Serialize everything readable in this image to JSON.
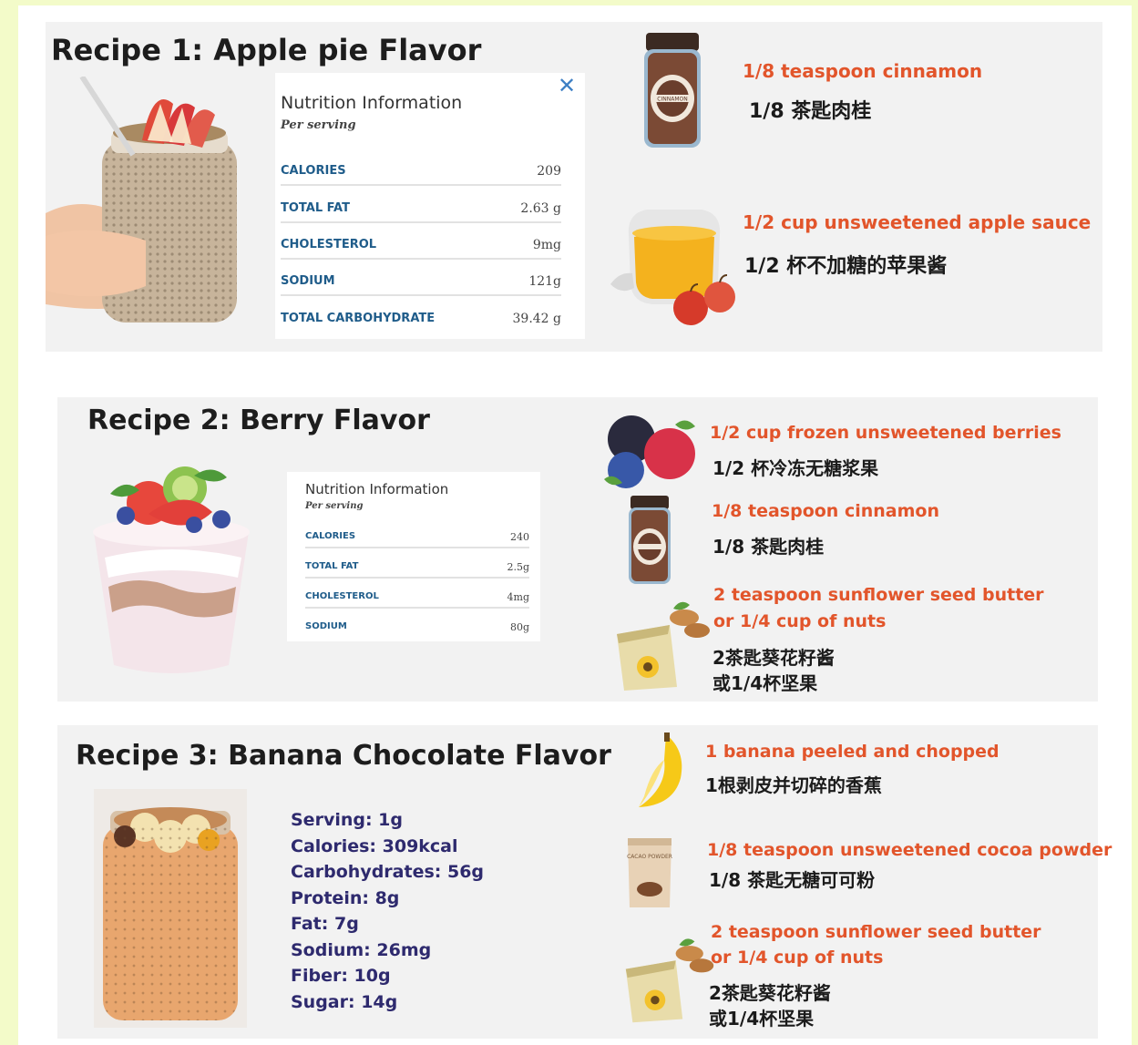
{
  "recipes": [
    {
      "title": "Recipe 1: Apple pie Flavor",
      "nutrition": {
        "heading": "Nutrition Information",
        "per": "Per serving",
        "rows": [
          {
            "label": "CALORIES",
            "value": "209"
          },
          {
            "label": "TOTAL FAT",
            "value": "2.63 g"
          },
          {
            "label": "CHOLESTEROL",
            "value": "9mg"
          },
          {
            "label": "SODIUM",
            "value": "121g"
          },
          {
            "label": "TOTAL CARBOHYDRATE",
            "value": "39.42 g"
          }
        ]
      },
      "ingredients": [
        {
          "en": "1/8 teaspoon cinnamon",
          "zh": "1/8 茶匙肉桂",
          "icon": "cinnamon-jar-icon"
        },
        {
          "en": "1/2 cup unsweetened apple sauce",
          "zh": "1/2 杯不加糖的苹果酱",
          "icon": "apple-sauce-jar-icon"
        }
      ]
    },
    {
      "title": "Recipe 2: Berry Flavor",
      "nutrition": {
        "heading": "Nutrition Information",
        "per": "Per serving",
        "rows": [
          {
            "label": "CALORIES",
            "value": "240"
          },
          {
            "label": "TOTAL FAT",
            "value": "2.5g"
          },
          {
            "label": "CHOLESTEROL",
            "value": "4mg"
          },
          {
            "label": "SODIUM",
            "value": "80g"
          }
        ]
      },
      "ingredients": [
        {
          "en": "1/2 cup frozen unsweetened berries",
          "zh": "1/2 杯冷冻无糖浆果",
          "icon": "berries-icon"
        },
        {
          "en": "1/8 teaspoon cinnamon",
          "zh": "1/8 茶匙肉桂",
          "icon": "cinnamon-jar-icon"
        },
        {
          "en": "2 teaspoon sunflower seed butter",
          "en2": "or 1/4 cup of nuts",
          "zh": "2茶匙葵花籽酱",
          "zh2": "或1/4杯坚果",
          "icon": "sunflower-seed-bag-icon"
        }
      ]
    },
    {
      "title": "Recipe 3: Banana Chocolate Flavor",
      "stats": [
        "Serving: 1g",
        "Calories: 309kcal",
        "Carbohydrates: 56g",
        "Protein: 8g",
        "Fat: 7g",
        "Sodium: 26mg",
        "Fiber: 10g",
        "Sugar: 14g"
      ],
      "ingredients": [
        {
          "en": "1 banana peeled and chopped",
          "zh": "1根剥皮并切碎的香蕉",
          "icon": "banana-icon"
        },
        {
          "en": "1/8 teaspoon unsweetened cocoa powder",
          "zh": "1/8 茶匙无糖可可粉",
          "icon": "cacao-powder-bag-icon",
          "bag_label": "CACAO POWDER"
        },
        {
          "en": "2 teaspoon sunflower seed butter",
          "en2": "or 1/4 cup of nuts",
          "zh": "2茶匙葵花籽酱",
          "zh2": "或1/4杯坚果",
          "icon": "sunflower-seed-bag-icon"
        }
      ]
    }
  ],
  "jar_label": "CINNAMON",
  "colors": {
    "background": "#f3fbc9",
    "card": "#f2f2f2",
    "ingredient_en": "#e2552b",
    "nutrient_label": "#1f5c8a",
    "stats": "#2e2a6e"
  }
}
